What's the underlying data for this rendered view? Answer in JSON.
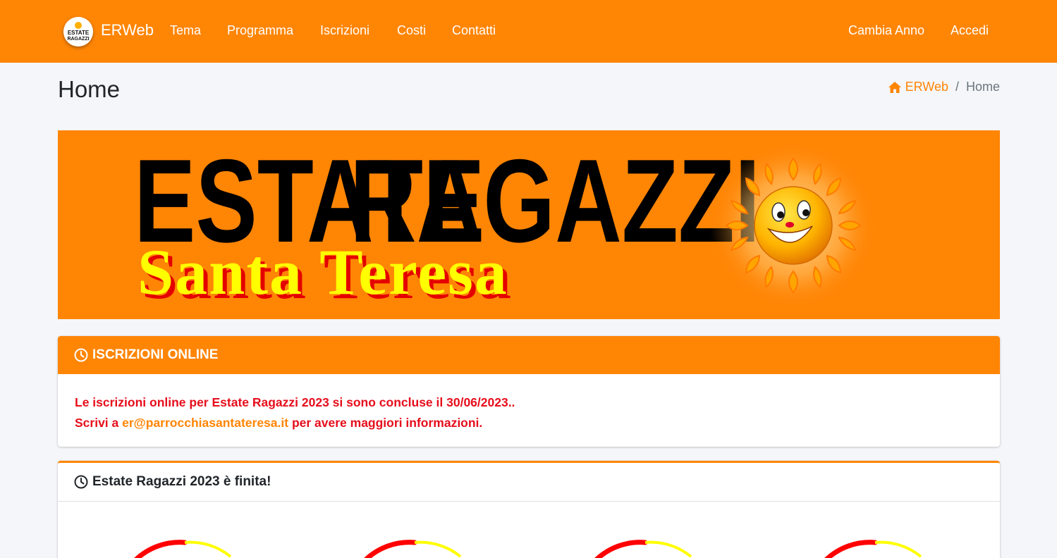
{
  "navbar": {
    "brand": "ERWeb",
    "logo_lettering": "ESTATE RAGAZZI",
    "links": [
      "Tema",
      "Programma",
      "Iscrizioni",
      "Costi",
      "Contatti"
    ],
    "right_links": [
      "Cambia Anno",
      "Accedi"
    ],
    "accent_color": "#ff8505"
  },
  "header": {
    "title": "Home",
    "breadcrumb": {
      "home_label": "ERWeb",
      "separator": "/",
      "current": "Home"
    }
  },
  "banner": {
    "line1_estate": "ESTATE",
    "line1_ragazzi": "RAGAZZI",
    "line2": "Santa Teresa",
    "icon": "sun-mascot"
  },
  "card_iscrizioni": {
    "icon": "clock-icon",
    "title": "ISCRIZIONI ONLINE",
    "line1": "Le iscrizioni online per Estate Ragazzi 2023 si sono concluse il 30/06/2023..",
    "line2_prefix": "Scrivi a ",
    "email": "er@parrocchiasantateresa.it",
    "line2_suffix": " per avere maggiori informazioni.",
    "text_color": "#e60e1c"
  },
  "card_countdown": {
    "icon": "clock-icon",
    "title": "Estate Ragazzi 2023 è finita!",
    "gauge_colors": [
      "#ff0000",
      "#ffff00"
    ]
  }
}
